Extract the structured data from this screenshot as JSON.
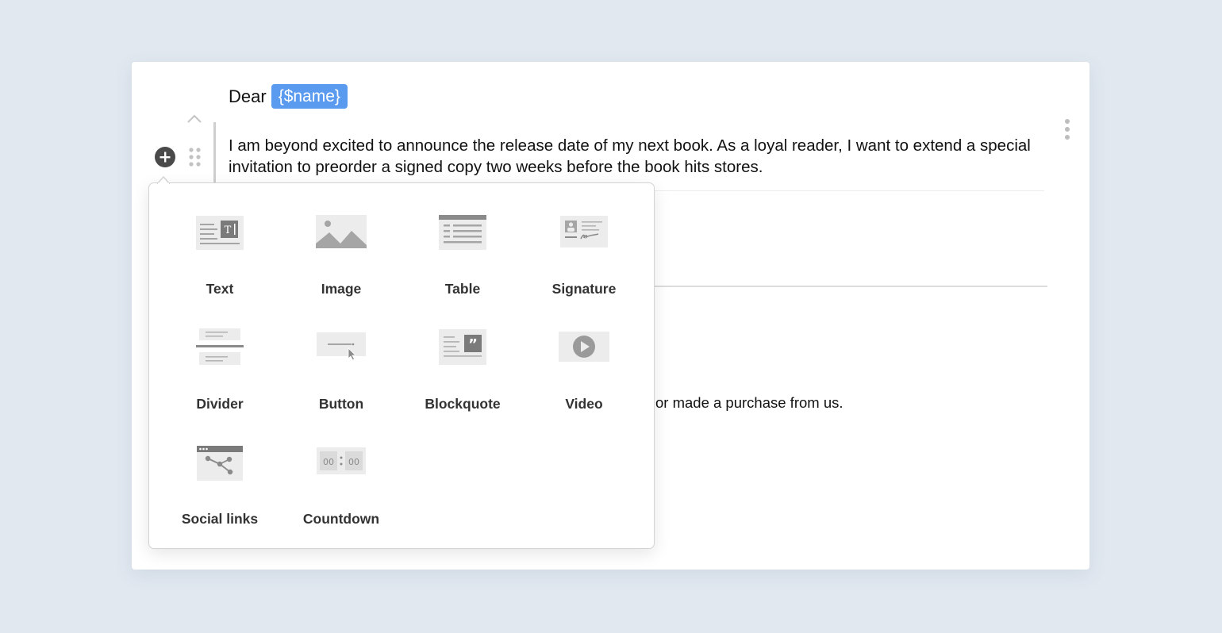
{
  "email": {
    "greeting": "Dear",
    "name_tag": "{$name}",
    "paragraph": "I am beyond excited to announce the release date of my next book. As a loyal reader, I want to extend a special invitation to preorder a signed copy two weeks before the book hits stores.",
    "partial_text": "or made a purchase from us."
  },
  "popup": {
    "items": [
      {
        "label": "Text",
        "icon": "text-block-icon"
      },
      {
        "label": "Image",
        "icon": "image-block-icon"
      },
      {
        "label": "Table",
        "icon": "table-block-icon"
      },
      {
        "label": "Signature",
        "icon": "signature-block-icon"
      },
      {
        "label": "Divider",
        "icon": "divider-block-icon"
      },
      {
        "label": "Button",
        "icon": "button-block-icon"
      },
      {
        "label": "Blockquote",
        "icon": "blockquote-block-icon"
      },
      {
        "label": "Video",
        "icon": "video-block-icon"
      },
      {
        "label": "Social links",
        "icon": "social-links-block-icon"
      },
      {
        "label": "Countdown",
        "icon": "countdown-block-icon"
      }
    ],
    "countdown_digits": [
      "00",
      "00"
    ]
  },
  "colors": {
    "background": "#e1e8f0",
    "accent": "#5a9bf0",
    "icon_gray": "#9a9a9a",
    "label": "#333333"
  }
}
